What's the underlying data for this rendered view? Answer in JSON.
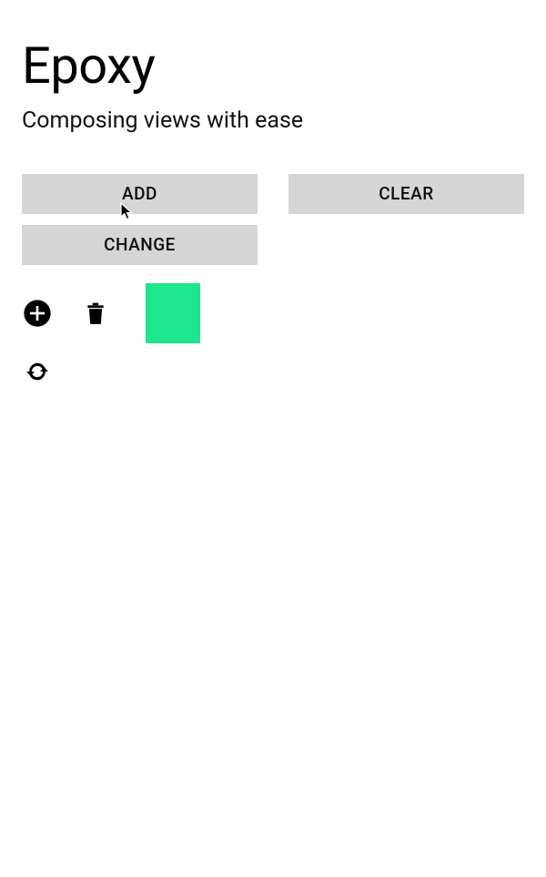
{
  "header": {
    "title": "Epoxy",
    "subtitle": "Composing views with ease"
  },
  "buttons": {
    "add": "ADD",
    "clear": "CLEAR",
    "change": "CHANGE"
  },
  "items": [
    {
      "color": "#1fe58d"
    }
  ],
  "icons": {
    "add": "add-circle",
    "delete": "trash",
    "refresh": "refresh"
  }
}
